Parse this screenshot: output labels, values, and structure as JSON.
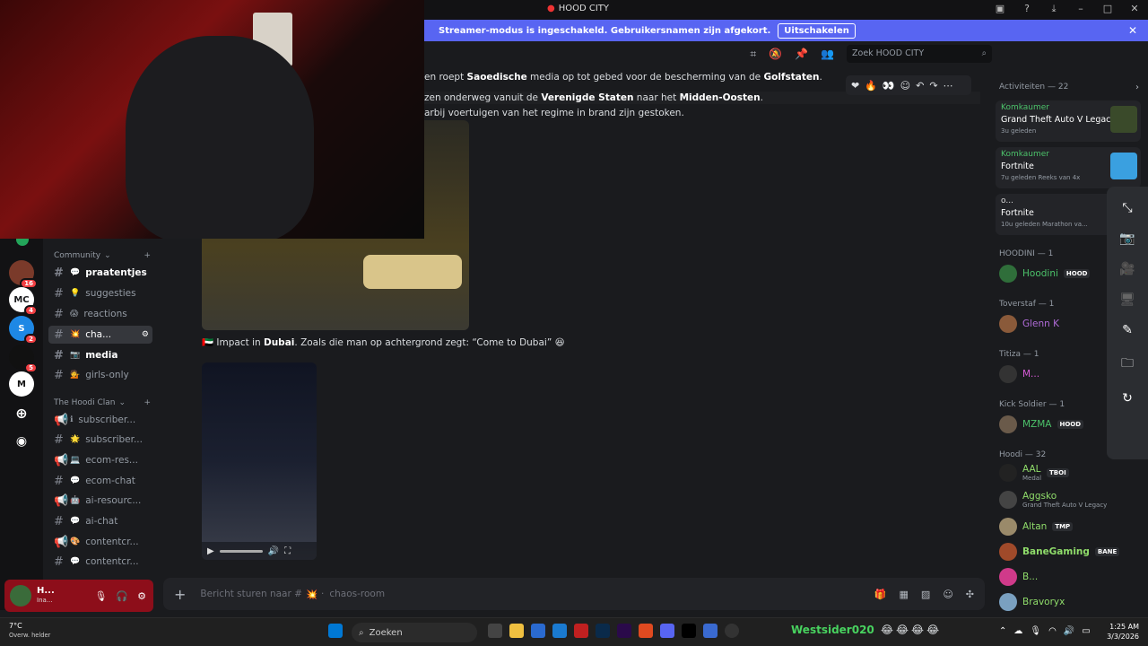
{
  "window": {
    "title": "HOOD CITY"
  },
  "banner": {
    "text": "Streamer-modus is ingeschakeld. Gebruikersnamen zijn afgekort.",
    "button": "Uitschakelen"
  },
  "search": {
    "placeholder": "Zoek HOOD CITY"
  },
  "servers": [
    {
      "label": "",
      "badge": "16"
    },
    {
      "label": "MC",
      "badge": "4"
    },
    {
      "label": "S",
      "badge": "2"
    },
    {
      "label": "",
      "badge": "5"
    },
    {
      "label": "M",
      "badge": ""
    }
  ],
  "categories": {
    "community": "Community",
    "hoodi": "The Hoodi Clan"
  },
  "channels": [
    {
      "name": "praatentjes",
      "bold": true
    },
    {
      "name": "suggesties",
      "bold": false
    },
    {
      "name": "reactions",
      "bold": false
    },
    {
      "name": "cha...",
      "bold": false,
      "active": true
    },
    {
      "name": "media",
      "bold": true
    },
    {
      "name": "girls-only",
      "bold": false
    },
    {
      "name": "subscriber...",
      "bold": false
    },
    {
      "name": "subscriber...",
      "bold": false
    },
    {
      "name": "ecom-res...",
      "bold": false
    },
    {
      "name": "ecom-chat",
      "bold": false
    },
    {
      "name": "ai-resourc...",
      "bold": false
    },
    {
      "name": "ai-chat",
      "bold": false
    },
    {
      "name": "contentcr...",
      "bold": false
    },
    {
      "name": "contentcr...",
      "bold": false
    }
  ],
  "user": {
    "name": "H...",
    "status": "Ina..."
  },
  "messages": [
    {
      "pre": "en roept ",
      "b1": "Saoedische",
      "mid": " media op tot gebed voor de bescherming van de ",
      "b2": "Golfstaten",
      "post": "."
    },
    {
      "pre": "zen onderweg vanuit de ",
      "b1": "Verenigde Staten",
      "mid": " naar het ",
      "b2": "Midden-Oosten",
      "post": "."
    },
    {
      "pre": "arbij voertuigen van het regime in brand zijn gestoken.",
      "b1": "",
      "mid": "",
      "b2": "",
      "post": ""
    }
  ],
  "caption": {
    "pre": "Impact in ",
    "bold": "Dubai",
    "post": ". Zoals die man op achtergrond zegt: “Come to Dubai” 😆"
  },
  "composer": {
    "placeholder": "Bericht sturen naar #",
    "channel": "chaos-room"
  },
  "activities": {
    "header": "Activiteiten — 22",
    "items": [
      {
        "who": "Komkaumer",
        "game": "Grand Theft Auto V Legacy",
        "meta": "3u geleden"
      },
      {
        "who": "Komkaumer",
        "game": "Fortnite",
        "meta": "7u geleden   Reeks van 4x"
      },
      {
        "who": "o...",
        "game": "Fortnite",
        "meta": "10u geleden   Marathon va..."
      }
    ]
  },
  "groups": [
    {
      "header": "HOODINI — 1",
      "members": [
        {
          "name": "Hoodini",
          "tag": "HOOD",
          "color": "#4cc26a"
        }
      ]
    },
    {
      "header": "Toverstaf — 1",
      "members": [
        {
          "name": "Glenn K",
          "tag": "",
          "color": "#b06bd8"
        }
      ]
    },
    {
      "header": "Titiza — 1",
      "members": [
        {
          "name": "M...",
          "tag": "",
          "color": "#d85bd8"
        }
      ]
    },
    {
      "header": "Kick Soldier — 1",
      "members": [
        {
          "name": "MZMA",
          "tag": "HOOD",
          "color": "#4cc26a"
        }
      ]
    },
    {
      "header": "Hoodi — 32",
      "members": [
        {
          "name": "AAL",
          "tag": "TBOI",
          "sub": "Medal",
          "color": "#8fdc6a"
        },
        {
          "name": "Aggsko",
          "tag": "",
          "sub": "Grand Theft Auto V Legacy",
          "color": "#8fdc6a"
        },
        {
          "name": "Altan",
          "tag": "TMP",
          "color": "#8fdc6a"
        },
        {
          "name": "BaneGaming",
          "tag": "BANE",
          "color": "#8fdc6a"
        },
        {
          "name": "B...",
          "tag": "",
          "color": "#8fdc6a"
        },
        {
          "name": "Bravoryx",
          "tag": "",
          "color": "#8fdc6a"
        }
      ]
    }
  ],
  "taskbar": {
    "temp": "7°C",
    "weather": "Overw. helder",
    "search": "Zoeken",
    "time": "1:25 AM",
    "date": "3/3/2026",
    "streamer": "Westsider020"
  }
}
